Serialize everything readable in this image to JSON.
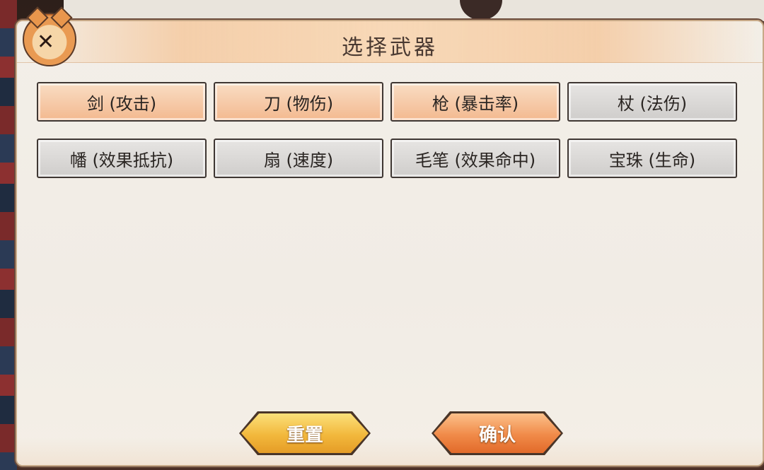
{
  "dialog": {
    "title": "选择武器"
  },
  "weapons": [
    {
      "label": "剑 (攻击)",
      "selected": true
    },
    {
      "label": "刀 (物伤)",
      "selected": true
    },
    {
      "label": "枪 (暴击率)",
      "selected": true
    },
    {
      "label": "杖 (法伤)",
      "selected": false
    },
    {
      "label": "幡 (效果抵抗)",
      "selected": false
    },
    {
      "label": "扇 (速度)",
      "selected": false
    },
    {
      "label": "毛笔 (效果命中)",
      "selected": false
    },
    {
      "label": "宝珠 (生命)",
      "selected": false
    }
  ],
  "actions": {
    "reset_label": "重置",
    "confirm_label": "确认"
  },
  "colors": {
    "selected_option": "#f3b98f",
    "normal_option": "#d8d6d4",
    "reset_button": "#f2b83c",
    "confirm_button": "#f08a48",
    "panel_background": "#f3efe8"
  },
  "icons": {
    "mascot": "tiger-mascot-icon"
  }
}
